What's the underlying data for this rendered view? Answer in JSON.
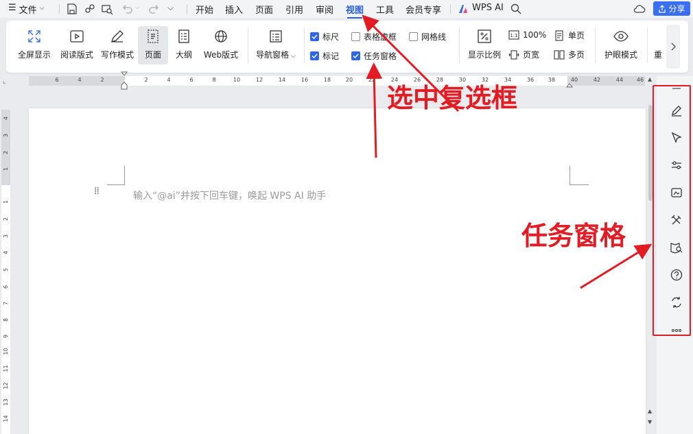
{
  "menubar": {
    "file_label": "文件",
    "tabs": [
      "开始",
      "插入",
      "页面",
      "引用",
      "审阅",
      "视图",
      "工具",
      "会员专享"
    ],
    "active_tab": "视图",
    "wps_ai_label": "WPS AI",
    "share_label": "分享"
  },
  "ribbon": {
    "buttons": [
      "全屏显示",
      "阅读版式",
      "写作模式",
      "页面",
      "大纲",
      "Web版式"
    ],
    "selected_button": "页面",
    "nav_pane": "导航窗格",
    "checkboxes": [
      {
        "label": "标尺",
        "checked": true
      },
      {
        "label": "表格虚框",
        "checked": false
      },
      {
        "label": "网格线",
        "checked": false
      },
      {
        "label": "标记",
        "checked": true
      },
      {
        "label": "任务窗格",
        "checked": true
      }
    ],
    "zoom_label": "显示比例",
    "zoom_100": "100%",
    "page_width": "页宽",
    "single_page": "单页",
    "multi_page": "多页",
    "eye_mode": "护眼模式",
    "cut_label": "重"
  },
  "ruler": {
    "left_ticks": [
      "6",
      "4",
      "2"
    ],
    "right_ticks": [
      "2",
      "4",
      "6",
      "8",
      "10",
      "12",
      "14",
      "16",
      "18",
      "20",
      "22",
      "24",
      "26",
      "28",
      "30",
      "32",
      "34",
      "36",
      "38",
      "40",
      "42",
      "44",
      "46"
    ],
    "vertical_top": [
      "4",
      "3",
      "2",
      "1"
    ],
    "vertical_body": [
      "1",
      "2",
      "2",
      "3",
      "4",
      "5",
      "6",
      "7",
      "8",
      "9",
      "10",
      "11",
      "12",
      "13",
      "14"
    ]
  },
  "document": {
    "placeholder": "输入“@ai”并按下回车键，唤起 WPS AI 助手"
  },
  "annotations": {
    "check_box_note": "选中复选框",
    "task_pane_note": "任务窗格"
  },
  "taskpane_icons": [
    "minus-icon",
    "pen-icon",
    "cursor-icon",
    "sliders-icon",
    "image-edit-icon",
    "tools-icon",
    "book-search-icon",
    "help-icon",
    "translate-icon",
    "more-icon"
  ],
  "colors": {
    "accent": "#2b5fd9",
    "share_bg": "#3a6ff2",
    "annotation": "#e31b23",
    "checkbox_on": "#2f66e8"
  }
}
